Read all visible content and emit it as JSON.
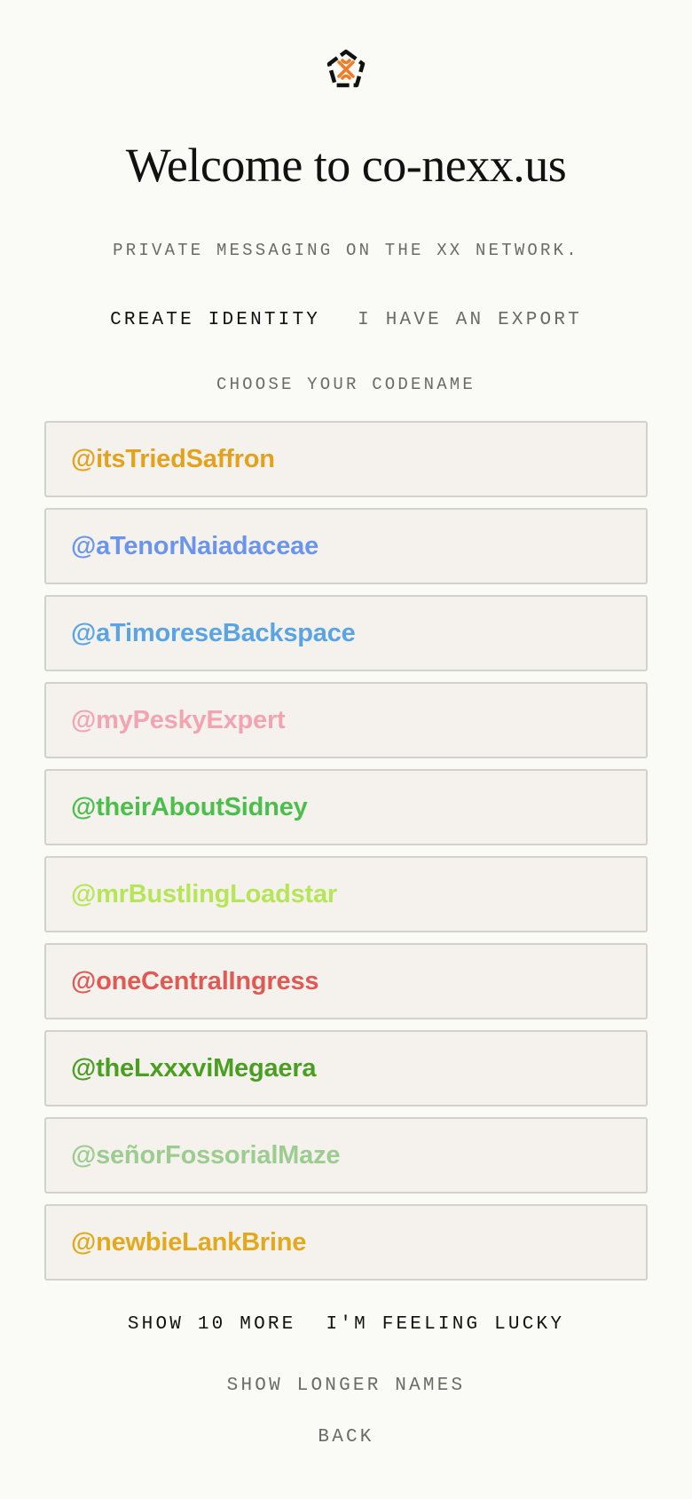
{
  "app": {
    "title": "Welcome to co-nexx.us",
    "subtitle": "PRIVATE MESSAGING ON THE XX NETWORK.",
    "logo_icon": "conexxus-pentagon-logo-icon"
  },
  "tabs": {
    "create": "CREATE IDENTITY",
    "export": "I HAVE AN EXPORT",
    "active": "create"
  },
  "codename_section": {
    "label": "CHOOSE YOUR CODENAME",
    "options": [
      {
        "name": "@itsTriedSaffron",
        "color": "#e3a21e"
      },
      {
        "name": "@aTenorNaiadaceae",
        "color": "#6b95ec"
      },
      {
        "name": "@aTimoreseBackspace",
        "color": "#5aa4e4"
      },
      {
        "name": "@myPeskyExpert",
        "color": "#f2a4b0"
      },
      {
        "name": "@theirAboutSidney",
        "color": "#4cbe4c"
      },
      {
        "name": "@mrBustlingLoadstar",
        "color": "#b6e55a"
      },
      {
        "name": "@oneCentralIngress",
        "color": "#e05a54"
      },
      {
        "name": "@theLxxxviMegaera",
        "color": "#4a9e22"
      },
      {
        "name": "@señorFossorialMaze",
        "color": "#9ccc90"
      },
      {
        "name": "@newbieLankBrine",
        "color": "#e3a91e"
      }
    ]
  },
  "actions": {
    "show_more": "SHOW 10 MORE",
    "lucky": "I'M FEELING LUCKY",
    "longer_names": "SHOW LONGER NAMES",
    "back": "BACK"
  },
  "colors": {
    "background": "#fafaf7",
    "card_background": "#f5f2ed",
    "card_border": "#d3d1cb",
    "text_primary": "#111111",
    "text_muted": "#6b6b66",
    "logo_accent": "#f07c2a"
  }
}
